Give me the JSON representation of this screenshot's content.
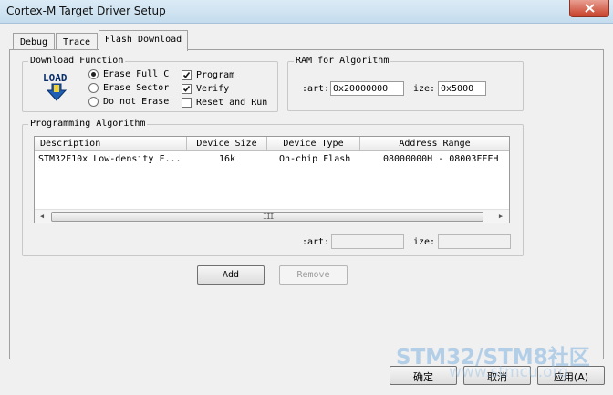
{
  "window": {
    "title": "Cortex-M Target Driver Setup"
  },
  "tabs": [
    {
      "label": "Debug"
    },
    {
      "label": "Trace"
    },
    {
      "label": "Flash Download"
    }
  ],
  "download_function": {
    "label": "Download Function",
    "load_icon_text": "LOAD",
    "radios": [
      {
        "label": "Erase Full C",
        "selected": true
      },
      {
        "label": "Erase Sector",
        "selected": false
      },
      {
        "label": "Do not Erase",
        "selected": false
      }
    ],
    "checks": [
      {
        "label": "Program",
        "checked": true
      },
      {
        "label": "Verify",
        "checked": true
      },
      {
        "label": "Reset and Run",
        "checked": false
      }
    ]
  },
  "ram": {
    "label": "RAM for Algorithm",
    "start_label": ":art:",
    "start_value": "0x20000000",
    "size_label": "ize:",
    "size_value": "0x5000"
  },
  "programming": {
    "label": "Programming Algorithm",
    "columns": [
      "Description",
      "Device Size",
      "Device Type",
      "Address Range"
    ],
    "rows": [
      {
        "description": "STM32F10x Low-density F...",
        "size": "16k",
        "type": "On-chip Flash",
        "range": "08000000H - 08003FFFH"
      }
    ],
    "scroll_grip": "III",
    "start_label": ":art:",
    "start_value": "",
    "size_label": "ize:",
    "size_value": ""
  },
  "buttons": {
    "add": "Add",
    "remove": "Remove"
  },
  "dialog_buttons": {
    "ok": "确定",
    "cancel": "取消",
    "apply": "应用(A)"
  },
  "watermark": {
    "line1": "STM32/STM8社区",
    "line2": "www.stmcu.org"
  },
  "colors": {
    "close": "#c8412a",
    "titlebar": "#c4dced",
    "face": "#f0f0f0"
  }
}
